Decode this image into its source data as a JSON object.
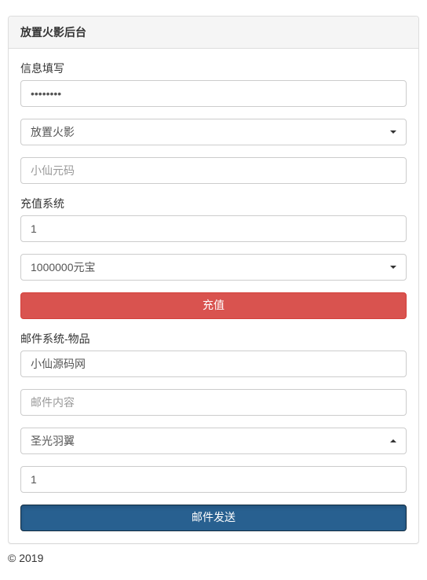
{
  "panel": {
    "title": "放置火影后台"
  },
  "info": {
    "label": "信息填写",
    "password_value": "••••••••",
    "game_select": "放置火影",
    "code_placeholder": "小仙元码"
  },
  "recharge": {
    "label": "充值系统",
    "quantity": "1",
    "amount_select": "1000000元宝",
    "button": "充值"
  },
  "mail": {
    "label": "邮件系统-物品",
    "recipient": "小仙源码网",
    "content_placeholder": "邮件内容",
    "item_select": "圣光羽翼",
    "quantity": "1",
    "send_button": "邮件发送"
  },
  "footer": "© 2019"
}
